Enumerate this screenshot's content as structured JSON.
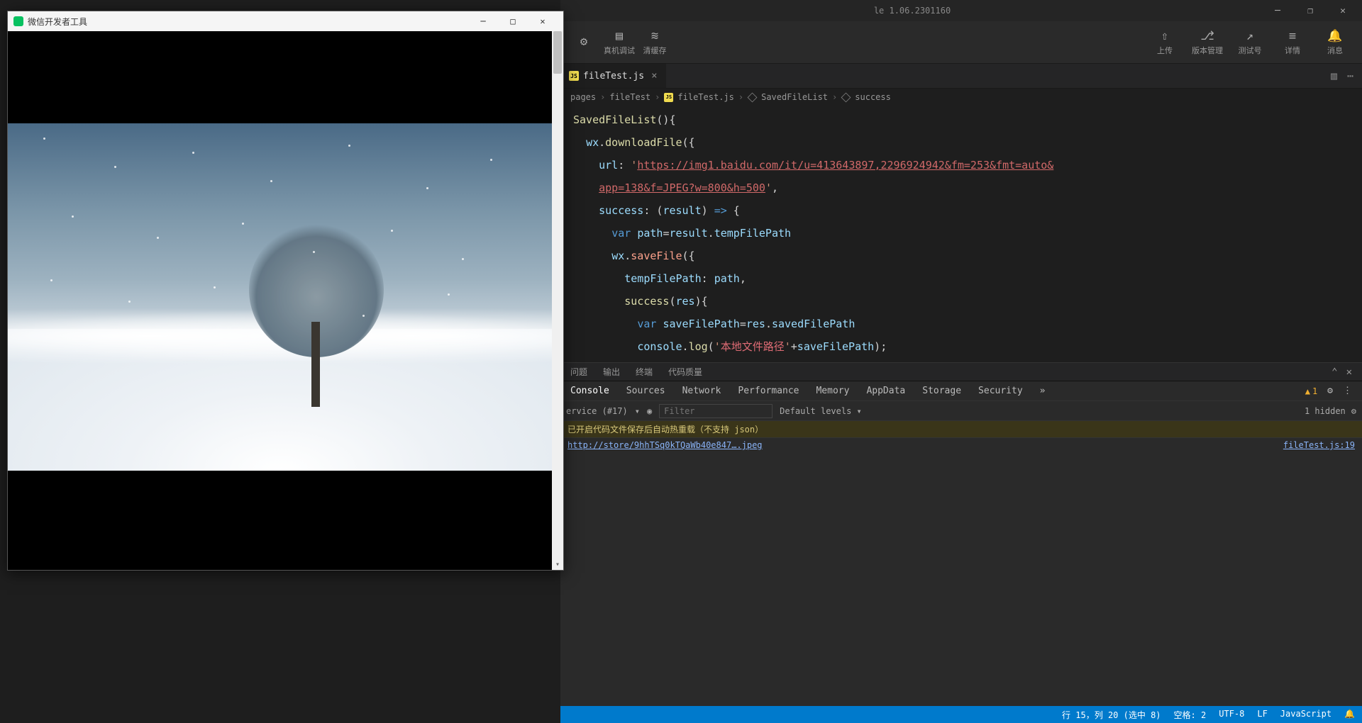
{
  "titlebar": {
    "title": "le 1.06.2301160"
  },
  "toolbtns": [
    {
      "label": "",
      "icon": "⚙"
    },
    {
      "label": "真机调试",
      "icon": "▤"
    },
    {
      "label": "清缓存",
      "icon": "⌫"
    }
  ],
  "toolright": [
    {
      "label": "上传",
      "icon": "⇧"
    },
    {
      "label": "版本管理",
      "icon": "⎇"
    },
    {
      "label": "测试号",
      "icon": "↗"
    },
    {
      "label": "详情",
      "icon": "≡"
    },
    {
      "label": "消息",
      "icon": "🔔"
    }
  ],
  "tab": {
    "name": "fileTest.js"
  },
  "crumbs": [
    "pages",
    "fileTest",
    "fileTest.js",
    "SavedFileList",
    "success"
  ],
  "code": {
    "l1a": "SavedFileList",
    "l1b": "(){",
    "l2a": "wx",
    "l2b": ".",
    "l2c": "downloadFile",
    "l2d": "({",
    "l3a": "url",
    "l3b": ": ",
    "l3c": "'",
    "l3d": "https://img1.baidu.com/it/u=413643897,2296924942&fm=253&fmt=auto&",
    "l3e": "app=138&f=JPEG?w=800&h=500",
    "l3f": "'",
    "l3g": ",",
    "l4a": "success",
    "l4b": ": (",
    "l4c": "result",
    "l4d": ") ",
    "l4e": "=>",
    "l4f": " {",
    "l5a": "var",
    "l5b": " ",
    "l5c": "path",
    "l5d": "=",
    "l5e": "result",
    "l5f": ".",
    "l5g": "tempFilePath",
    "l6a": "wx",
    "l6b": ".",
    "l6c": "saveFile",
    "l6d": "({",
    "l7a": "tempFilePath",
    "l7b": ": ",
    "l7c": "path",
    "l7d": ",",
    "l8a": "success",
    "l8b": "(",
    "l8c": "res",
    "l8d": "){",
    "l9a": "var",
    "l9b": " ",
    "l9c": "saveFilePath",
    "l9d": "=",
    "l9e": "res",
    "l9f": ".",
    "l9g": "savedFilePath",
    "l10a": "console",
    "l10b": ".",
    "l10c": "log",
    "l10d": "(",
    "l10e": "'",
    "l10f": "本地文件路径",
    "l10g": "'",
    "l10h": "+",
    "l10i": "saveFilePath",
    "l10j": ");",
    "l11": "}",
    "l12": "})",
    "l13": "},"
  },
  "paneltabs": {
    "items": [
      "问题",
      "输出",
      "终端",
      "代码质量"
    ]
  },
  "devtabs": {
    "items": [
      "Console",
      "Sources",
      "Network",
      "Performance",
      "Memory",
      "AppData",
      "Storage",
      "Security"
    ],
    "more": "»",
    "warncount": "1"
  },
  "filterrow": {
    "service": "ervice (#17)",
    "placeholder": "Filter",
    "levels": "Default levels",
    "hidden": "1 hidden"
  },
  "console": {
    "warnline": "已开启代码文件保存后自动热重载（不支持 json）",
    "link": "http://store/9hhTSq0kTQaWb40e847….jpeg",
    "src": "fileTest.js:19"
  },
  "status": {
    "pos": "行 15，列 20 (选中 8)",
    "spaces": "空格: 2",
    "enc": "UTF-8",
    "eol": "LF",
    "lang": "JavaScript"
  },
  "sim": {
    "title": "微信开发者工具"
  }
}
